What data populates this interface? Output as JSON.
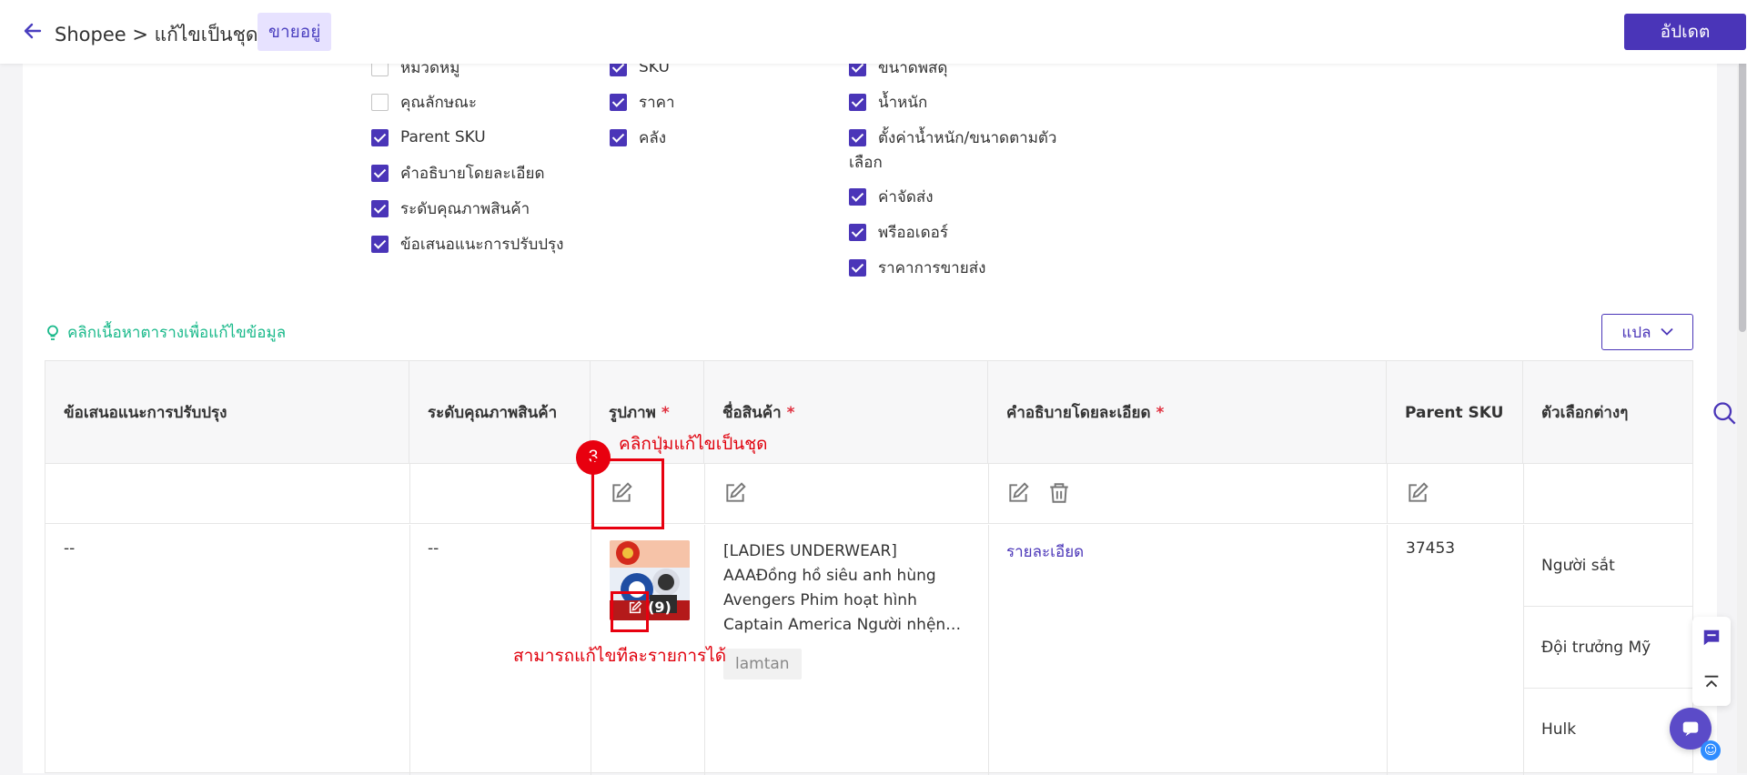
{
  "header": {
    "breadcrumb": "Shopee > แก้ไขเป็นชุด",
    "status": "ขายอยู่",
    "update_button": "อัปเดต"
  },
  "fields": {
    "col1": [
      {
        "label": "หมวดหมู่",
        "checked": false
      },
      {
        "label": "คุณลักษณะ",
        "checked": false
      },
      {
        "label": "Parent SKU",
        "checked": true
      },
      {
        "label": "คำอธิบายโดยละเอียด",
        "checked": true
      },
      {
        "label": "ระดับคุณภาพสินค้า",
        "checked": true
      },
      {
        "label": "ข้อเสนอแนะการปรับปรุง",
        "checked": true
      }
    ],
    "col2": [
      {
        "label": "SKU",
        "checked": true
      },
      {
        "label": "ราคา",
        "checked": true
      },
      {
        "label": "คลัง",
        "checked": true
      }
    ],
    "col3": [
      {
        "label": "ขนาดพัสดุ",
        "checked": true
      },
      {
        "label": "น้ำหนัก",
        "checked": true
      },
      {
        "label": "ตั้งค่าน้ำหนัก/ขนาดตามตัว",
        "label2": "เลือก",
        "checked": true
      },
      {
        "label": "ค่าจัดส่ง",
        "checked": true
      },
      {
        "label": "พรีออเดอร์",
        "checked": true
      },
      {
        "label": "ราคาการขายส่ง",
        "checked": true
      }
    ]
  },
  "hint": "คลิกเนื้อหาตารางเพื่อแก้ไขข้อมูล",
  "translate_button": "แปล",
  "table": {
    "columns": [
      {
        "label": "ข้อเสนอแนะการปรับปรุง",
        "required": false
      },
      {
        "label": "ระดับคุณภาพสินค้า",
        "required": false
      },
      {
        "label": "รูปภาพ",
        "required": true
      },
      {
        "label": "ชื่อสินค้า",
        "required": true
      },
      {
        "label": "คำอธิบายโดยละเอียด",
        "required": true
      },
      {
        "label": "Parent SKU",
        "required": false
      },
      {
        "label": "ตัวเลือกต่างๆ",
        "required": false
      }
    ],
    "required_mark": "*",
    "row": {
      "suggestion": "--",
      "quality": "--",
      "image_count": "(9)",
      "product_name": "[LADIES UNDERWEAR] AAAĐồng hồ siêu anh hùng Avengers Phim hoạt hình Captain America Người nhện…",
      "tag": "lamtan",
      "description_link": "รายละเอียด",
      "parent_sku": "37453",
      "variants": [
        "Người sắt",
        "Đội trưởng Mỹ",
        "Hulk"
      ]
    }
  },
  "annotations": {
    "step": "3",
    "bulk_edit_text": "คลิกปุ่มแก้ไขเป็นชุด",
    "item_edit_text": "สามารถแก้ไขทีละรายการได้",
    "color": "#e8000f"
  },
  "colors": {
    "accent": "#4a35b8",
    "hint": "#19b98a",
    "required": "#e0303f"
  }
}
